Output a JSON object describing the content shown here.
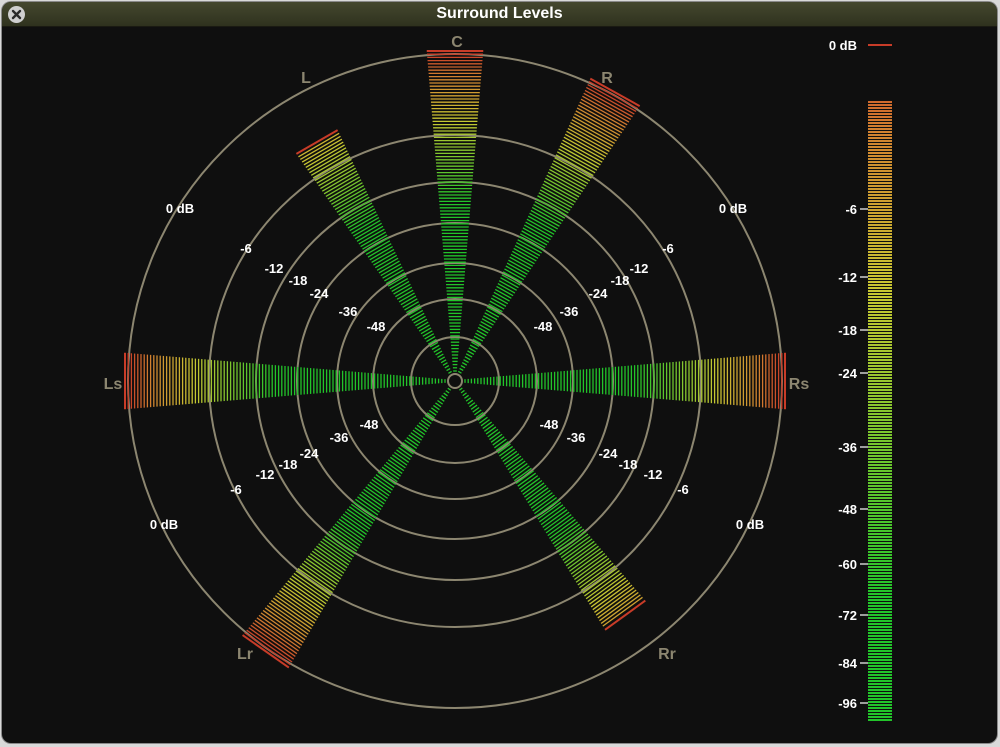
{
  "window": {
    "title": "Surround Levels",
    "close_icon": "close-x-icon"
  },
  "meter": {
    "rings_db": [
      -48,
      -36,
      -24,
      -18,
      -12,
      -6,
      0
    ],
    "ring_labels": [
      "0 dB",
      "-6",
      "-12",
      "-18",
      "-24",
      "-36",
      "-48"
    ],
    "channels": [
      {
        "name": "C",
        "level_db": 0
      },
      {
        "name": "R",
        "level_db": 0
      },
      {
        "name": "L",
        "level_db": -4
      },
      {
        "name": "Rs",
        "level_db": 0
      },
      {
        "name": "Ls",
        "level_db": 0
      },
      {
        "name": "Rr",
        "level_db": -3
      },
      {
        "name": "Lr",
        "level_db": 0
      }
    ],
    "colors": {
      "ring": "#8c8670",
      "label": "#ffffff",
      "channel_label": "#8c8670",
      "green": "#22c42a",
      "yellow": "#c8c832",
      "orange": "#d08030",
      "red": "#c83c28"
    }
  },
  "bar_meter": {
    "scale_labels": [
      "0 dB",
      "-6",
      "-12",
      "-18",
      "-24",
      "-36",
      "-48",
      "-60",
      "-72",
      "-84",
      "-96"
    ],
    "scale_db": [
      0,
      -6,
      -12,
      -18,
      -24,
      -36,
      -48,
      -60,
      -72,
      -84,
      -96
    ],
    "level_db": -2
  }
}
